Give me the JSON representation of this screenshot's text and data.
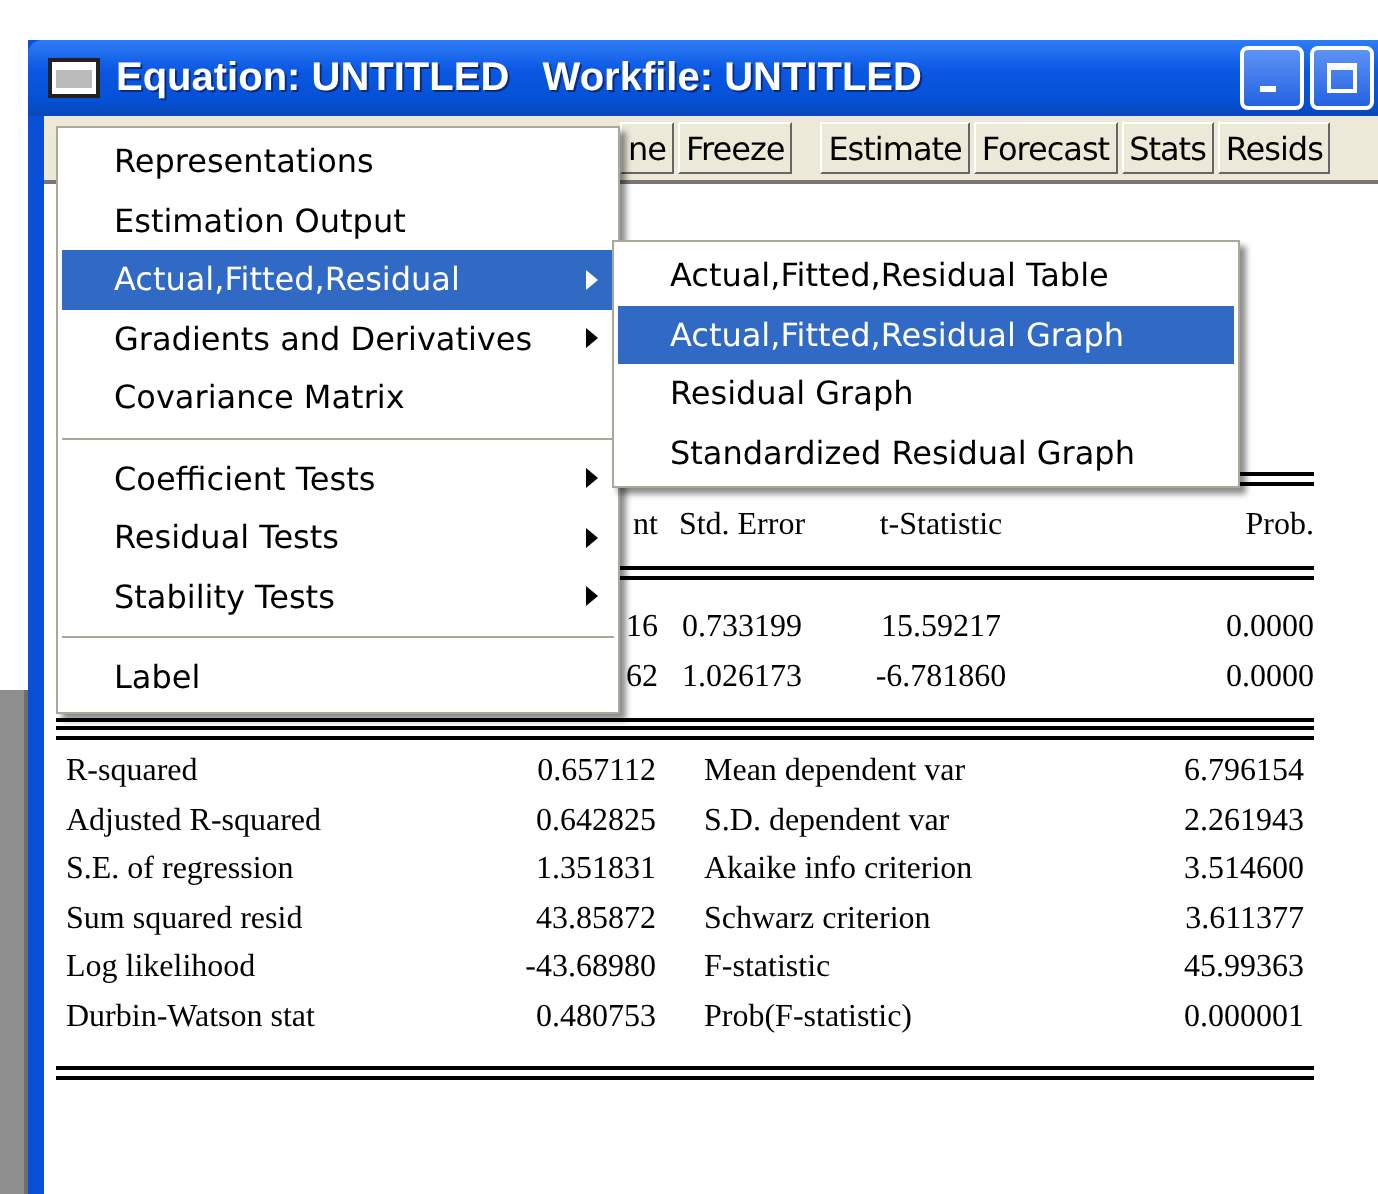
{
  "window": {
    "title": "Equation: UNTITLED   Workfile: UNTITLED"
  },
  "toolbar": [
    {
      "label": "ne"
    },
    {
      "label": "Freeze"
    },
    {
      "label": "Estimate"
    },
    {
      "label": "Forecast"
    },
    {
      "label": "Stats"
    },
    {
      "label": "Resids"
    }
  ],
  "coefficients": {
    "columns": [
      "nt",
      "Std. Error",
      "t-Statistic",
      "Prob."
    ],
    "rows": [
      [
        "16",
        "0.733199",
        "15.59217",
        "0.0000"
      ],
      [
        "62",
        "1.026173",
        "-6.781860",
        "0.0000"
      ]
    ]
  },
  "statistics": [
    [
      "R-squared",
      "0.657112",
      "Mean dependent var",
      "6.796154"
    ],
    [
      "Adjusted R-squared",
      "0.642825",
      "S.D. dependent var",
      "2.261943"
    ],
    [
      "S.E. of regression",
      "1.351831",
      "Akaike info criterion",
      "3.514600"
    ],
    [
      "Sum squared resid",
      "43.85872",
      "Schwarz criterion",
      "3.611377"
    ],
    [
      "Log likelihood",
      "-43.68980",
      "F-statistic",
      "45.99363"
    ],
    [
      "Durbin-Watson stat",
      "0.480753",
      "Prob(F-statistic)",
      "0.000001"
    ]
  ],
  "menu": [
    {
      "kind": "item",
      "label": "Representations",
      "submenu": false,
      "selected": false
    },
    {
      "kind": "item",
      "label": "Estimation Output",
      "submenu": false,
      "selected": false
    },
    {
      "kind": "item",
      "label": "Actual,Fitted,Residual",
      "submenu": true,
      "selected": true
    },
    {
      "kind": "item",
      "label": "Gradients and Derivatives",
      "submenu": true,
      "selected": false
    },
    {
      "kind": "item",
      "label": "Covariance Matrix",
      "submenu": false,
      "selected": false
    },
    {
      "kind": "separator"
    },
    {
      "kind": "item",
      "label": "Coefficient Tests",
      "submenu": true,
      "selected": false
    },
    {
      "kind": "item",
      "label": "Residual Tests",
      "submenu": true,
      "selected": false
    },
    {
      "kind": "item",
      "label": "Stability Tests",
      "submenu": true,
      "selected": false
    },
    {
      "kind": "separator"
    },
    {
      "kind": "item",
      "label": "Label",
      "submenu": false,
      "selected": false
    }
  ],
  "submenu": [
    {
      "label": "Actual,Fitted,Residual Table",
      "selected": false
    },
    {
      "label": "Actual,Fitted,Residual Graph",
      "selected": true
    },
    {
      "label": "Residual Graph",
      "selected": false
    },
    {
      "label": "Standardized Residual Graph",
      "selected": false
    }
  ]
}
